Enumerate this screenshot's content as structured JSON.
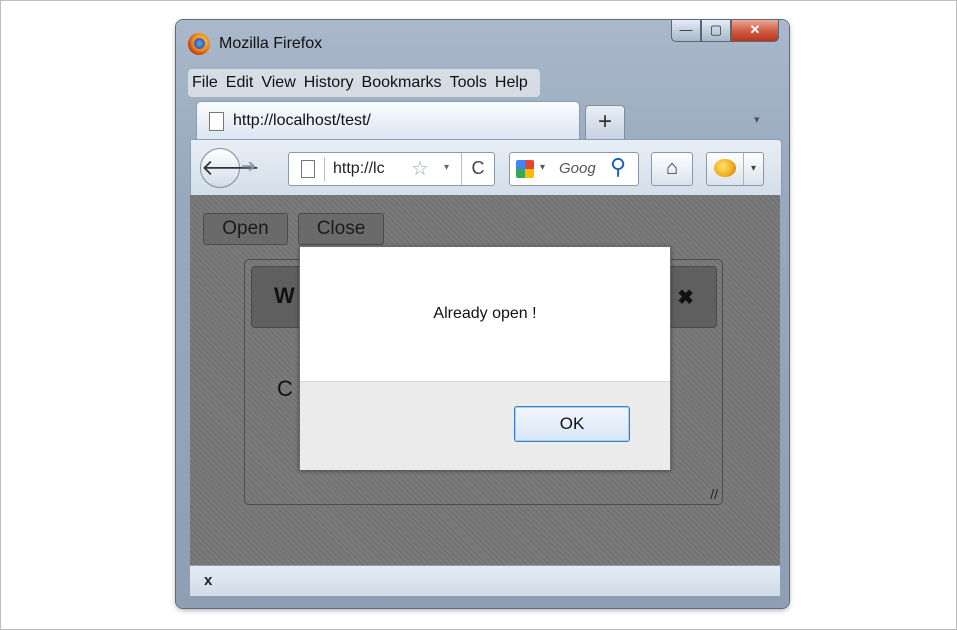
{
  "window": {
    "title": "Mozilla Firefox",
    "icon": "firefox-logo-icon",
    "caption_buttons": {
      "minimize": "—",
      "maximize": "▢",
      "close": "✕"
    }
  },
  "menubar": {
    "items": [
      "File",
      "Edit",
      "View",
      "History",
      "Bookmarks",
      "Tools",
      "Help"
    ]
  },
  "tabs": [
    {
      "label": "http://localhost/test/",
      "icon": "page-icon"
    }
  ],
  "newtab_label": "+",
  "tabs_menu_glyph": "▾",
  "navbar": {
    "back_glyph": "🡐",
    "forward_glyph": "➔",
    "url_value": "http://lc",
    "bookmark_glyph": "☆",
    "url_drop_glyph": "▾",
    "reload_glyph": "C",
    "search_drop_glyph": "▾",
    "search_placeholder": "Goog",
    "search_glyph": "⚲",
    "home_glyph": "⌂",
    "addon_drop_glyph": "▾"
  },
  "page": {
    "open_label": "Open",
    "close_label": "Close",
    "inner_dialog": {
      "title": "W",
      "close_glyph": "✖",
      "body_text": "C",
      "resize_glyph": "//"
    }
  },
  "alert": {
    "message": "Already open !",
    "ok_label": "OK"
  },
  "statusbar": {
    "close_glyph": "x"
  },
  "colors": {
    "overlay_bg": "#777777",
    "alert_footer": "#ebebeb",
    "ok_border": "#3b7bc4"
  }
}
